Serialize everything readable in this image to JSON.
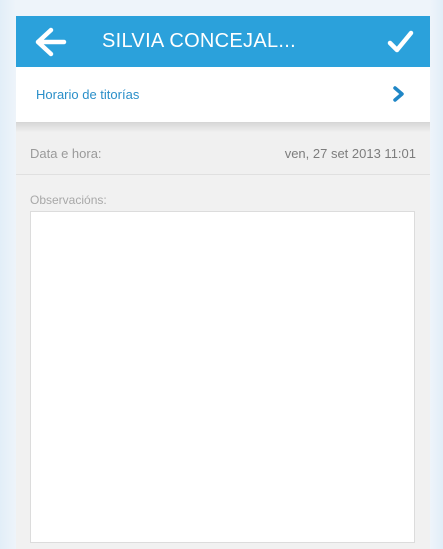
{
  "header": {
    "title": "SILVIA CONCEJAL...",
    "back_icon": "arrow-left-icon",
    "confirm_icon": "checkmark-icon",
    "color": "#2ba1db"
  },
  "menu": {
    "schedule_label": "Horario de titorías",
    "chevron_icon": "chevron-right-icon",
    "accent": "#2a8fc9"
  },
  "datetime": {
    "label": "Data e hora:",
    "value": "ven, 27 set 2013 11:01"
  },
  "observations": {
    "label": "Observacións:",
    "value": ""
  }
}
